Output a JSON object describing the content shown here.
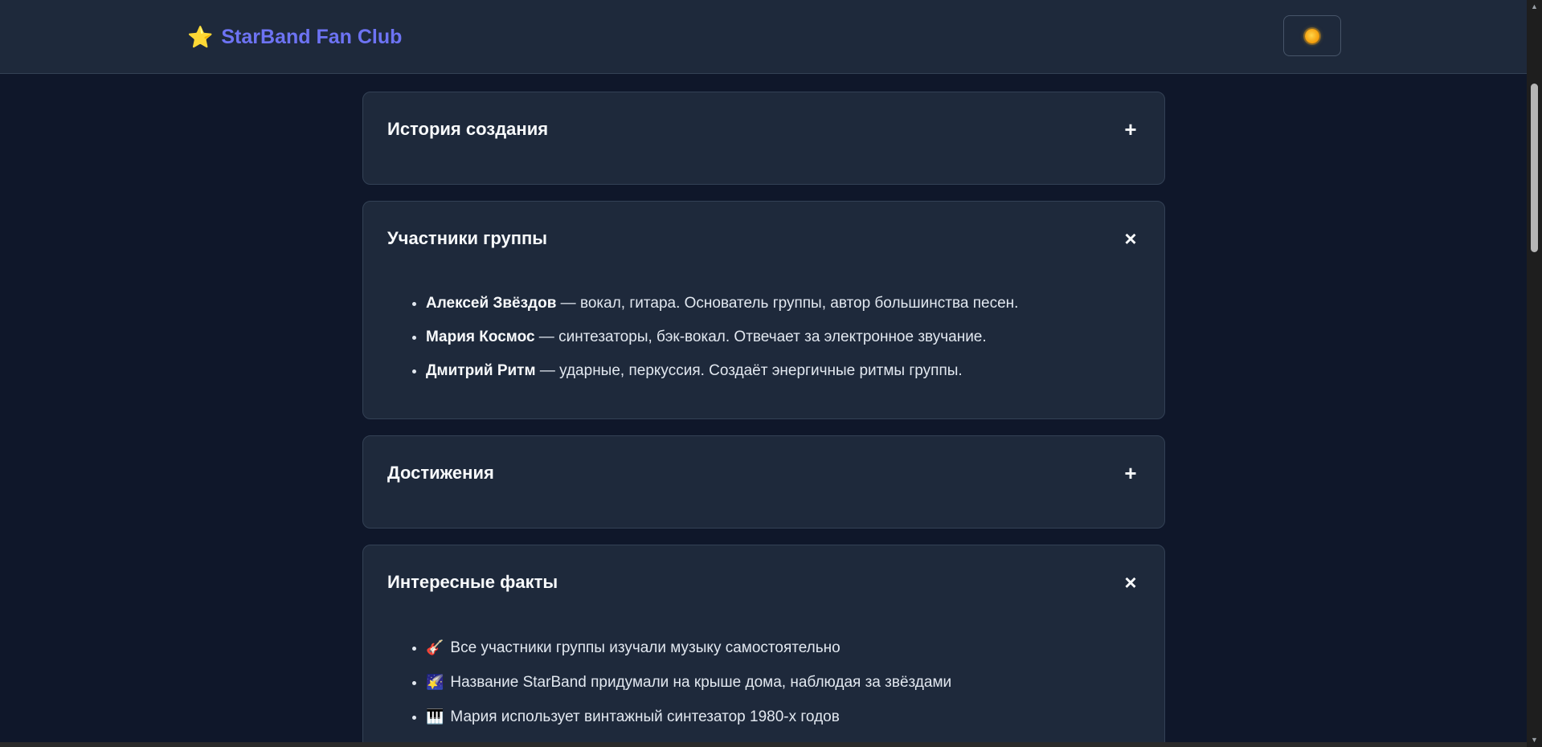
{
  "header": {
    "brand_icon": "star-icon",
    "brand_icon_glyph": "⭐",
    "brand_title": "StarBand Fan Club",
    "brand_color": "#6d73f3",
    "theme_toggle_icon": "sun-icon"
  },
  "accordion": [
    {
      "title": "История создания",
      "sign": "+",
      "expanded": false
    },
    {
      "title": "Участники группы",
      "sign": "×",
      "expanded": true,
      "members": [
        {
          "name": "Алексей Звёздов",
          "desc": " — вокал, гитара. Основатель группы, автор большинства песен."
        },
        {
          "name": "Мария Космос",
          "desc": " — синтезаторы, бэк-вокал. Отвечает за электронное звучание."
        },
        {
          "name": "Дмитрий Ритм",
          "desc": " — ударные, перкуссия. Создаёт энергичные ритмы группы."
        }
      ]
    },
    {
      "title": "Достижения",
      "sign": "+",
      "expanded": false
    },
    {
      "title": "Интересные факты",
      "sign": "×",
      "expanded": true,
      "facts": [
        {
          "icon": "guitar-icon",
          "glyph": "🎸",
          "text": "Все участники группы изучали музыку самостоятельно"
        },
        {
          "icon": "shooting-star-icon",
          "glyph": "🌠",
          "text": "Название StarBand придумали на крыше дома, наблюдая за звёздами"
        },
        {
          "icon": "keyboard-icon",
          "glyph": "🎹",
          "text": "Мария использует винтажный синтезатор 1980-х годов"
        }
      ]
    }
  ]
}
